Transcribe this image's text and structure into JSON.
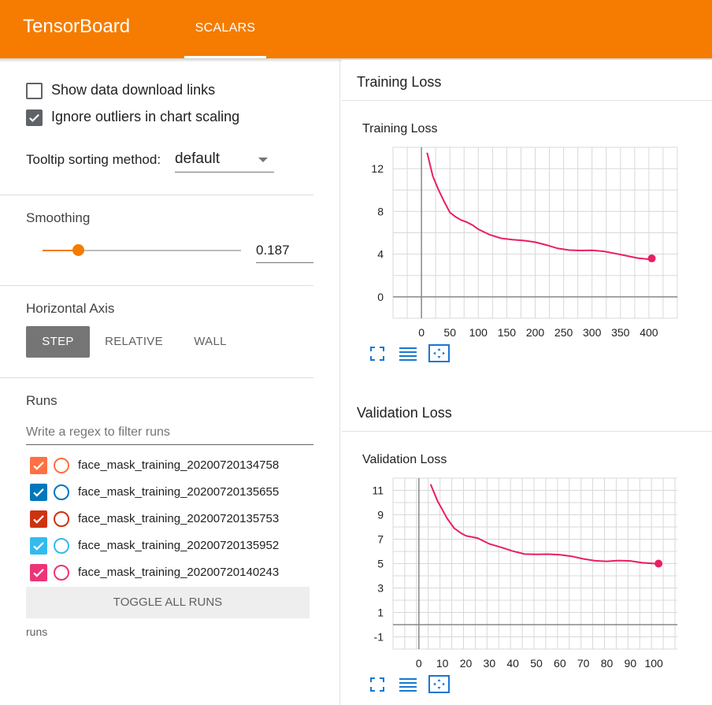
{
  "app": {
    "title": "TensorBoard",
    "tab": "SCALARS"
  },
  "sidebar": {
    "show_download_links": {
      "label": "Show data download links",
      "checked": false
    },
    "ignore_outliers": {
      "label": "Ignore outliers in chart scaling",
      "checked": true
    },
    "tooltip_sorting": {
      "label": "Tooltip sorting method:",
      "value": "default"
    },
    "smoothing": {
      "title": "Smoothing",
      "value": "0.187",
      "fraction": 0.187
    },
    "horizontal_axis": {
      "title": "Horizontal Axis",
      "options": [
        "STEP",
        "RELATIVE",
        "WALL"
      ],
      "selected": "STEP"
    },
    "runs": {
      "title": "Runs",
      "filter_placeholder": "Write a regex to filter runs",
      "items": [
        {
          "name": "face_mask_training_20200720134758",
          "color": "#ff7043",
          "checked": true
        },
        {
          "name": "face_mask_training_20200720135655",
          "color": "#0077bb",
          "checked": true
        },
        {
          "name": "face_mask_training_20200720135753",
          "color": "#cc3311",
          "checked": true
        },
        {
          "name": "face_mask_training_20200720135952",
          "color": "#33bbee",
          "checked": true
        },
        {
          "name": "face_mask_training_20200720140243",
          "color": "#ee3377",
          "checked": true
        }
      ],
      "toggle_label": "TOGGLE ALL RUNS",
      "footer": "runs"
    }
  },
  "groups": [
    {
      "header": "Training Loss"
    },
    {
      "header": "Validation Loss"
    }
  ],
  "chart_data": [
    {
      "type": "line",
      "title": "Training Loss",
      "xticks": [
        0,
        50,
        100,
        150,
        200,
        250,
        300,
        350,
        400
      ],
      "yticks": [
        0,
        4,
        8,
        12
      ],
      "xlim": [
        -50,
        450
      ],
      "ylim": [
        -2,
        14
      ],
      "series": [
        {
          "color": "#e91e63",
          "x": [
            10,
            20,
            30,
            40,
            50,
            60,
            70,
            80,
            90,
            100,
            120,
            140,
            160,
            180,
            200,
            220,
            240,
            260,
            280,
            300,
            320,
            340,
            360,
            380,
            400,
            405
          ],
          "y": [
            13.5,
            11.2,
            9.9,
            8.9,
            8.0,
            7.6,
            7.2,
            6.9,
            6.6,
            6.3,
            5.9,
            5.6,
            5.4,
            5.2,
            5.0,
            4.8,
            4.6,
            4.5,
            4.4,
            4.3,
            4.15,
            4.0,
            3.9,
            3.75,
            3.6,
            3.6
          ]
        }
      ]
    },
    {
      "type": "line",
      "title": "Validation Loss",
      "xticks": [
        0,
        10,
        20,
        30,
        40,
        50,
        60,
        70,
        80,
        90,
        100
      ],
      "yticks": [
        -1,
        1,
        3,
        5,
        7,
        9,
        11
      ],
      "xlim": [
        -11,
        110
      ],
      "ylim": [
        -2,
        12
      ],
      "series": [
        {
          "color": "#e91e63",
          "x": [
            5,
            8,
            10,
            12,
            15,
            18,
            20,
            25,
            30,
            35,
            40,
            45,
            50,
            55,
            60,
            65,
            70,
            75,
            80,
            85,
            90,
            95,
            100,
            102
          ],
          "y": [
            11.5,
            10.0,
            9.3,
            8.7,
            8.0,
            7.6,
            7.3,
            7.0,
            6.5,
            6.3,
            6.1,
            5.9,
            5.8,
            5.7,
            5.6,
            5.55,
            5.45,
            5.35,
            5.25,
            5.2,
            5.1,
            5.0,
            5.05,
            5.0
          ]
        }
      ]
    }
  ]
}
